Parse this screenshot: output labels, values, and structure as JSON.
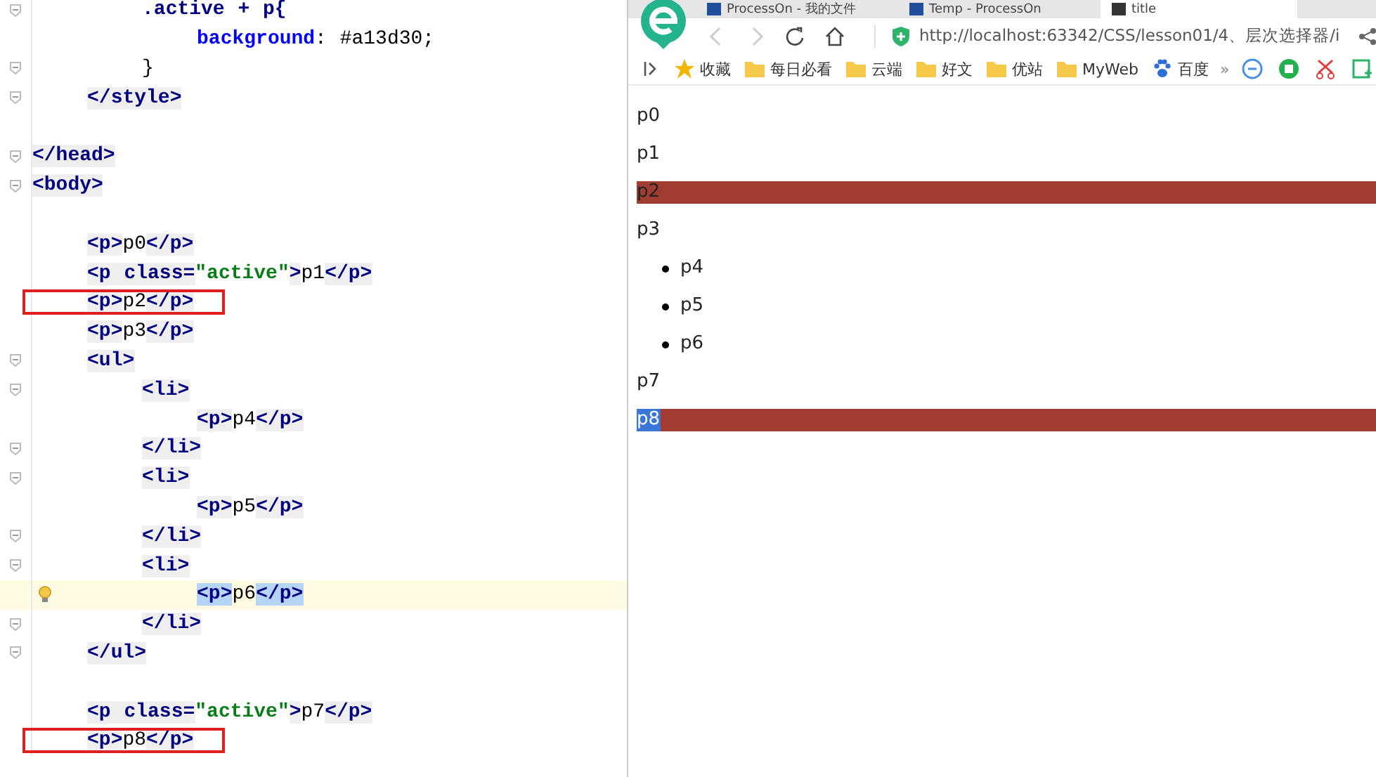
{
  "editor": {
    "lines": [
      {
        "text": "        .active + p{",
        "fold": true,
        "current": false,
        "boxed": false
      },
      {
        "text": "            background: #a13d30;",
        "fold": false,
        "current": false,
        "boxed": false
      },
      {
        "text": "        }",
        "fold": true,
        "current": false,
        "boxed": false
      },
      {
        "text": "    </style>",
        "fold": true,
        "current": false,
        "boxed": false
      },
      {
        "fold": false,
        "current": false,
        "boxed": false
      },
      {
        "text": "</head>",
        "fold": true,
        "current": false,
        "boxed": false
      },
      {
        "text": "<body>",
        "fold": true,
        "current": false,
        "boxed": false
      },
      {
        "fold": false,
        "current": false,
        "boxed": false
      },
      {
        "text": "    <p>p0</p>",
        "fold": false,
        "current": false,
        "boxed": false
      },
      {
        "text": "    <p class=\"active\">p1</p>",
        "fold": false,
        "current": false,
        "boxed": false
      },
      {
        "text": "    <p>p2</p>",
        "fold": false,
        "current": false,
        "boxed": true
      },
      {
        "text": "    <p>p3</p>",
        "fold": false,
        "current": false,
        "boxed": false
      },
      {
        "text": "    <ul>",
        "fold": true,
        "current": false,
        "boxed": false
      },
      {
        "text": "        <li>",
        "fold": true,
        "current": false,
        "boxed": false
      },
      {
        "text": "            <p>p4</p>",
        "fold": false,
        "current": false,
        "boxed": false
      },
      {
        "text": "        </li>",
        "fold": true,
        "current": false,
        "boxed": false
      },
      {
        "text": "        <li>",
        "fold": true,
        "current": false,
        "boxed": false
      },
      {
        "text": "            <p>p5</p>",
        "fold": false,
        "current": false,
        "boxed": false
      },
      {
        "text": "        </li>",
        "fold": true,
        "current": false,
        "boxed": false
      },
      {
        "text": "        <li>",
        "fold": true,
        "current": false,
        "boxed": false
      },
      {
        "text": "            <p>p6</p>",
        "fold": false,
        "current": true,
        "boxed": false
      },
      {
        "text": "        </li>",
        "fold": true,
        "current": false,
        "boxed": false
      },
      {
        "text": "    </ul>",
        "fold": true,
        "current": false,
        "boxed": false
      },
      {
        "fold": false,
        "current": false,
        "boxed": false
      },
      {
        "text": "    <p class=\"active\">p7</p>",
        "fold": false,
        "current": false,
        "boxed": false
      },
      {
        "text": "    <p>p8</p>",
        "fold": false,
        "current": false,
        "boxed": true
      }
    ]
  },
  "browser": {
    "tabs": [
      {
        "label": "ProcessOn - 我的文件",
        "selected": false
      },
      {
        "label": "Temp - ProcessOn",
        "selected": false
      },
      {
        "label": "title",
        "selected": true
      }
    ],
    "address": "http://localhost:63342/CSS/lesson01/4、层次选择器/i",
    "bookmarks": [
      {
        "label": "收藏",
        "kind": "star"
      },
      {
        "label": "每日必看",
        "kind": "folder"
      },
      {
        "label": "云端",
        "kind": "folder"
      },
      {
        "label": "好文",
        "kind": "folder"
      },
      {
        "label": "优站",
        "kind": "folder"
      },
      {
        "label": "MyWeb",
        "kind": "folder"
      },
      {
        "label": "百度",
        "kind": "paw"
      }
    ],
    "more": "»",
    "content": [
      {
        "text": "p0",
        "kind": "p",
        "highlighted": false,
        "selected": false
      },
      {
        "text": "p1",
        "kind": "p",
        "highlighted": false,
        "selected": false
      },
      {
        "text": "p2",
        "kind": "p",
        "highlighted": true,
        "selected": false
      },
      {
        "text": "p3",
        "kind": "p",
        "highlighted": false,
        "selected": false
      },
      {
        "text": "p4",
        "kind": "li",
        "highlighted": false,
        "selected": false
      },
      {
        "text": "p5",
        "kind": "li",
        "highlighted": false,
        "selected": false
      },
      {
        "text": "p6",
        "kind": "li",
        "highlighted": false,
        "selected": false
      },
      {
        "text": "p7",
        "kind": "p",
        "highlighted": false,
        "selected": false
      },
      {
        "text": "p8",
        "kind": "p",
        "highlighted": true,
        "selected": true
      }
    ]
  }
}
